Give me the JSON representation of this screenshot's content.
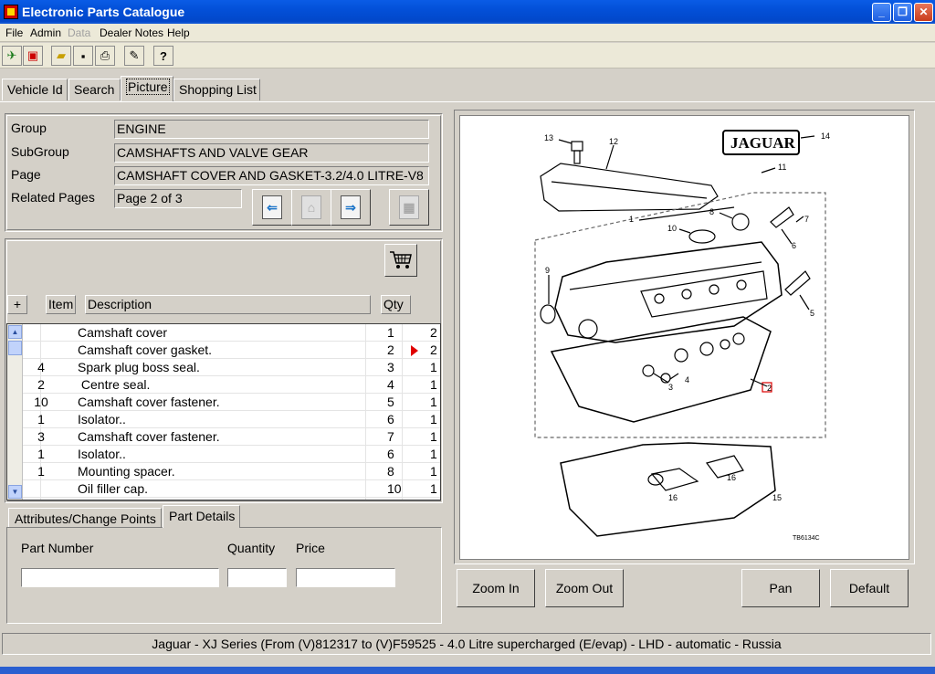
{
  "window": {
    "title": "Electronic Parts Catalogue"
  },
  "menu": [
    "File",
    "Admin",
    "Data",
    "Dealer Notes",
    "Help"
  ],
  "tabs": [
    "Vehicle Id",
    "Search",
    "Picture",
    "Shopping List"
  ],
  "group": {
    "group_label": "Group",
    "group_value": "ENGINE",
    "subgroup_label": "SubGroup",
    "subgroup_value": "CAMSHAFTS AND VALVE GEAR",
    "page_label": "Page",
    "page_value": "CAMSHAFT COVER AND GASKET-3.2/4.0 LITRE-V8",
    "related_label": "Related Pages",
    "related_value": "Page 2 of 3"
  },
  "parts_header": {
    "plus": "+",
    "item": "Item",
    "description": "Description",
    "qty": "Qty"
  },
  "parts": [
    {
      "item": "",
      "description": "Camshaft cover",
      "ref": "1",
      "qty": "2",
      "selected": false
    },
    {
      "item": "",
      "description": "Camshaft cover gasket.",
      "ref": "2",
      "qty": "2",
      "selected": true
    },
    {
      "item": "4",
      "description": "Spark plug boss seal.",
      "ref": "3",
      "qty": "1",
      "selected": false
    },
    {
      "item": "2",
      "description": " Centre seal.",
      "ref": "4",
      "qty": "1",
      "selected": false
    },
    {
      "item": "10",
      "description": "Camshaft cover fastener.",
      "ref": "5",
      "qty": "1",
      "selected": false
    },
    {
      "item": "1",
      "description": "Isolator..",
      "ref": "6",
      "qty": "1",
      "selected": false
    },
    {
      "item": "3",
      "description": "Camshaft cover fastener.",
      "ref": "7",
      "qty": "1",
      "selected": false
    },
    {
      "item": "1",
      "description": "Isolator..",
      "ref": "6",
      "qty": "1",
      "selected": false
    },
    {
      "item": "1",
      "description": "Mounting spacer.",
      "ref": "8",
      "qty": "1",
      "selected": false
    },
    {
      "item": "",
      "description": "Oil filler cap.",
      "ref": "10",
      "qty": "1",
      "selected": false
    }
  ],
  "subtabs": [
    "Attributes/Change Points",
    "Part Details"
  ],
  "details": {
    "part_number_label": "Part Number",
    "quantity_label": "Quantity",
    "price_label": "Price",
    "part_number": "",
    "quantity": "",
    "price": ""
  },
  "diagram": {
    "brand": "JAGUAR",
    "code": "TB6134C",
    "callouts": [
      "13",
      "12",
      "14",
      "11",
      "1",
      "10",
      "8",
      "7",
      "6",
      "9",
      "5",
      "4",
      "3",
      "2",
      "16",
      "16",
      "15"
    ]
  },
  "buttons": {
    "zoom_in": "Zoom In",
    "zoom_out": "Zoom Out",
    "pan": "Pan",
    "default": "Default"
  },
  "status": "Jaguar - XJ Series (From (V)812317 to (V)F59525 - 4.0 Litre supercharged (E/evap) - LHD - automatic - Russia",
  "icons": {
    "cart": "shopping-cart-icon",
    "prev": "previous-page-icon",
    "home": "home-page-icon",
    "next": "next-page-icon",
    "related": "related-page-icon"
  }
}
